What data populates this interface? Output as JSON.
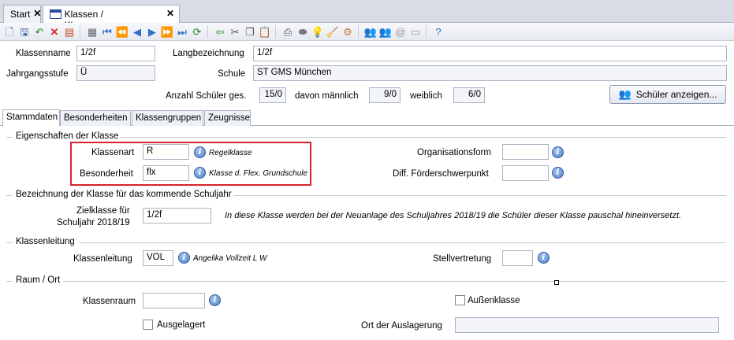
{
  "tabs": [
    {
      "label": "Start"
    },
    {
      "label": "Klassen / Klassengruppen"
    }
  ],
  "header": {
    "klassenname_label": "Klassenname",
    "klassenname_value": "1/2f",
    "langbezeichnung_label": "Langbezeichnung",
    "langbezeichnung_value": "1/2f",
    "jahrgangsstufe_label": "Jahrgangsstufe",
    "jahrgangsstufe_value": "Ü",
    "schule_label": "Schule",
    "schule_value": "ST GMS München",
    "anzahl_label": "Anzahl Schüler ges.",
    "anzahl_value": "15/0",
    "maennlich_label": "davon männlich",
    "maennlich_value": "9/0",
    "weiblich_label": "weiblich",
    "weiblich_value": "6/0",
    "show_students_button": "Schüler anzeigen..."
  },
  "subtabs": [
    {
      "label": "Stammdaten"
    },
    {
      "label": "Besonderheiten"
    },
    {
      "label": "Klassengruppen"
    },
    {
      "label": "Zeugnisse"
    }
  ],
  "eigenschaften": {
    "title": "Eigenschaften der Klasse",
    "klassenart_label": "Klassenart",
    "klassenart_value": "R",
    "klassenart_hint": "Regelklasse",
    "besonderheit_label": "Besonderheit",
    "besonderheit_value": "flx",
    "besonderheit_hint": "Klasse d. Flex. Grundschule",
    "organisationsform_label": "Organisationsform",
    "organisationsform_value": "",
    "foerder_label": "Diff. Förderschwerpunkt",
    "foerder_value": ""
  },
  "folgejahr": {
    "title": "Bezeichnung der Klasse für das kommende Schuljahr",
    "zielklasse_label_1": "Zielklasse für",
    "zielklasse_label_2": "Schuljahr 2018/19",
    "zielklasse_value": "1/2f",
    "note": "In diese Klasse werden bei der Neuanlage des Schuljahres 2018/19 die Schüler dieser Klasse pauschal hineinversetzt."
  },
  "klassenleitung": {
    "title": "Klassenleitung",
    "label": "Klassenleitung",
    "value": "VOL",
    "hint": "Angelika Vollzeit L W",
    "stellvertretung_label": "Stellvertretung",
    "stellvertretung_value": ""
  },
  "raum": {
    "title": "Raum / Ort",
    "klassenraum_label": "Klassenraum",
    "klassenraum_value": "",
    "aussenklasse_label": "Außenklasse",
    "ausgelagert_label": "Ausgelagert",
    "ort_label": "Ort der Auslagerung",
    "ort_value": ""
  },
  "colors": {
    "highlight_border": "#d9232c",
    "tab_background": "#d7dce5",
    "info_icon": "#4a7ec8"
  }
}
